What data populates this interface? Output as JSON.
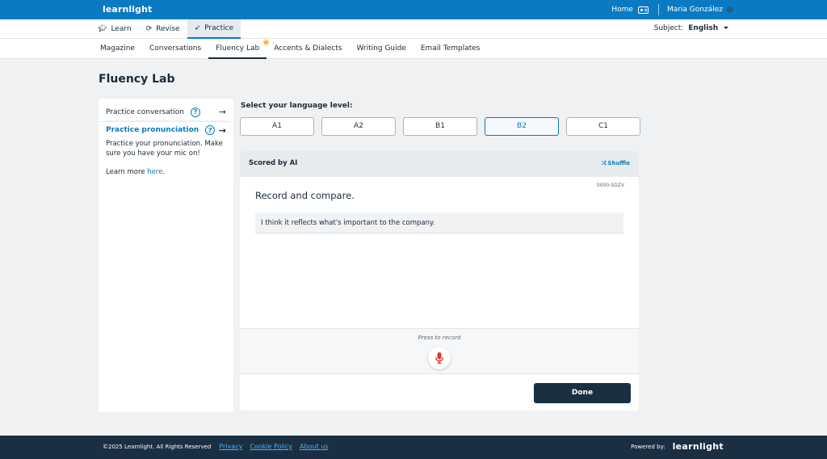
{
  "app": {
    "brand": "learnlight"
  },
  "topbar": {
    "home_label": "Home",
    "user_name": "Maria González"
  },
  "nav1": {
    "items": [
      {
        "label": "Learn",
        "icon": "graduation-cap-icon"
      },
      {
        "label": "Revise",
        "icon": "refresh-icon"
      },
      {
        "label": "Practice",
        "icon": "rocket-icon",
        "active": true
      }
    ],
    "subject_label": "Subject:",
    "subject_value": "English"
  },
  "nav2": {
    "items": [
      {
        "label": "Magazine"
      },
      {
        "label": "Conversations"
      },
      {
        "label": "Fluency Lab",
        "active": true
      },
      {
        "label": "Accents & Dialects"
      },
      {
        "label": "Writing Guide"
      },
      {
        "label": "Email Templates"
      }
    ]
  },
  "page": {
    "title": "Fluency Lab"
  },
  "sidebar": {
    "items": [
      {
        "label": "Practice conversation"
      },
      {
        "label": "Practice pronunciation",
        "active": true
      }
    ],
    "description": "Practice your pronunciation. Make sure you have your mic on!",
    "learn_more_prefix": "Learn more",
    "learn_more_link": "here",
    "learn_more_suffix": "."
  },
  "levels": {
    "label": "Select your language level:",
    "options": [
      "A1",
      "A2",
      "B1",
      "B2",
      "C1"
    ],
    "selected": "B2"
  },
  "card": {
    "header": "Scored by AI",
    "shuffle_label": "Shuffle",
    "code": "0000-5DZV",
    "instruction": "Record and compare.",
    "sentence": "I think it reflects what's important to the company.",
    "record_hint": "Press to record",
    "done_label": "Done"
  },
  "footer": {
    "copyright": "©2025 Learnlight. All Rights Reserved",
    "links": [
      "Privacy",
      "Cookie Policy",
      "About us"
    ],
    "powered_by": "Powered by:",
    "brand": "learnlight"
  },
  "colors": {
    "primary": "#0a7bc2",
    "dark": "#1a2f42",
    "accent": "#f5b335",
    "mic": "#e0362d"
  }
}
